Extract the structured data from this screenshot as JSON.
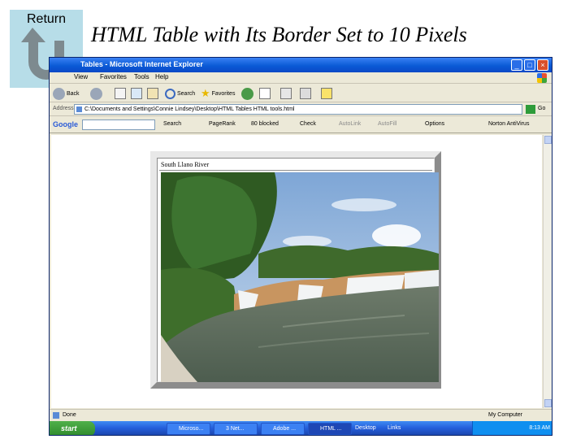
{
  "slide": {
    "return_label": "Return",
    "title": "HTML Table with Its Border Set to 10 Pixels"
  },
  "browser": {
    "title": "Tables - Microsoft Internet Explorer",
    "window_buttons": [
      "_",
      "□",
      "×"
    ],
    "menu": [
      "View",
      "Favorites",
      "Tools",
      "Help"
    ],
    "toolbar": {
      "back": "Back",
      "search": "Search",
      "favorites": "Favorites"
    },
    "address": {
      "label": "Address",
      "value": "C:\\Documents and Settings\\Connie Lindsey\\Desktop\\HTML Tables HTML tools.html",
      "go": "Go"
    },
    "google_bar": {
      "logo": "Google",
      "search": "Search",
      "pagerank": "PageRank",
      "blocked": "80 blocked",
      "check": "Check",
      "autolink": "AutoLink",
      "autofill": "AutoFill",
      "options": "Options",
      "norton": "Norton AntiVirus"
    },
    "table": {
      "caption": "South Llano River"
    },
    "status": {
      "text": "Done",
      "zone": "My Computer"
    },
    "taskbar": {
      "start": "start",
      "items": [
        "Microso...",
        "3 Net...",
        "Adobe ...",
        "HTML ..."
      ],
      "desktop": "Desktop",
      "links": "Links",
      "time": "8:13 AM"
    }
  }
}
